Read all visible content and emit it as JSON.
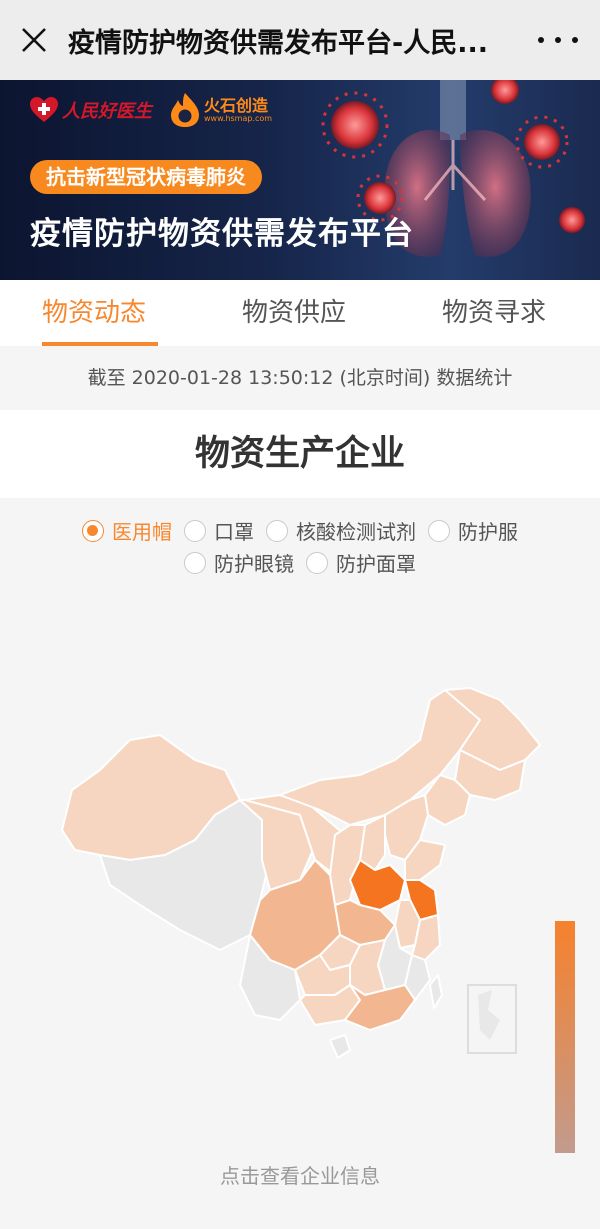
{
  "header": {
    "title": "疫情防护物资供需发布平台-人民...",
    "close_icon": "close-icon",
    "more_icon": "more-dots-icon"
  },
  "banner": {
    "brand1": "人民好医生",
    "brand2": "火石创造",
    "brand2_sub": "www.hsmap.com",
    "tagline": "抗击新型冠状病毒肺炎",
    "title": "疫情防护物资供需发布平台"
  },
  "tabs": [
    {
      "label": "物资动态",
      "active": true
    },
    {
      "label": "物资供应",
      "active": false
    },
    {
      "label": "物资寻求",
      "active": false
    }
  ],
  "stats_line": "截至 2020-01-28 13:50:12 (北京时间) 数据统计",
  "section_title": "物资生产企业",
  "filters": {
    "options": [
      "医用帽",
      "口罩",
      "核酸检测试剂",
      "防护服",
      "防护眼镜",
      "防护面罩"
    ],
    "selected": "医用帽"
  },
  "map": {
    "legend_colors": {
      "high": "#f6812d",
      "low": "#c29b8d"
    },
    "region_colors": {
      "none": "#e8e8e8",
      "light": "#f6d6c0",
      "mid": "#f2b690",
      "high": "#f5741f"
    },
    "hint": "点击查看企业信息"
  }
}
